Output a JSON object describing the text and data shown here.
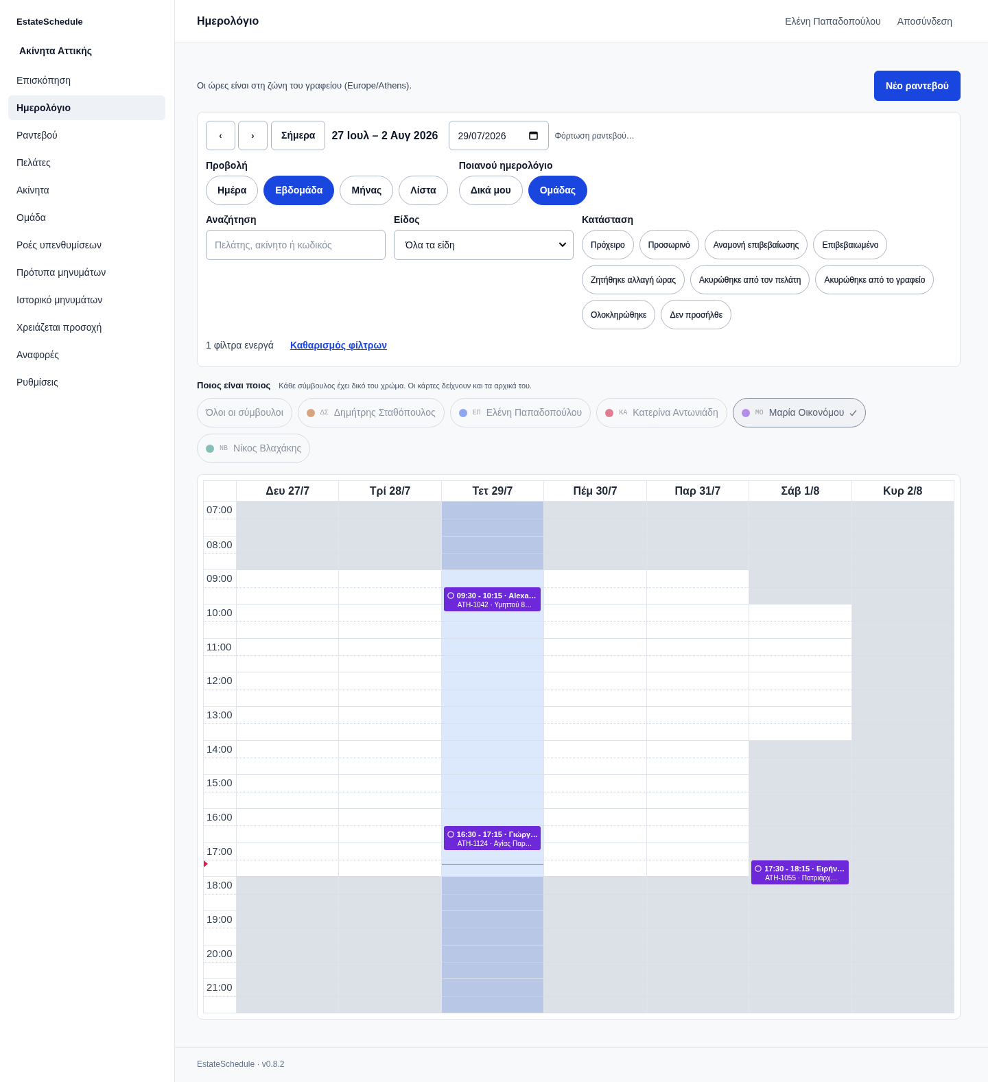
{
  "sidebar": {
    "brand": "EstateSchedule",
    "workspace": "Ακίνητα Αττικής",
    "items": [
      {
        "label": "Επισκόπηση",
        "selected": false
      },
      {
        "label": "Ημερολόγιο",
        "selected": true
      },
      {
        "label": "Ραντεβού",
        "selected": false
      },
      {
        "label": "Πελάτες",
        "selected": false
      },
      {
        "label": "Ακίνητα",
        "selected": false
      },
      {
        "label": "Ομάδα",
        "selected": false
      },
      {
        "label": "Ροές υπενθυμίσεων",
        "selected": false
      },
      {
        "label": "Πρότυπα μηνυμάτων",
        "selected": false
      },
      {
        "label": "Ιστορικό μηνυμάτων",
        "selected": false
      },
      {
        "label": "Χρειάζεται προσοχή",
        "selected": false
      },
      {
        "label": "Αναφορές",
        "selected": false
      },
      {
        "label": "Ρυθμίσεις",
        "selected": false
      }
    ]
  },
  "header": {
    "title": "Ημερολόγιο",
    "user": "Ελένη Παπαδοπούλου",
    "logout": "Αποσύνδεση"
  },
  "intro": {
    "note": "Οι ώρες είναι στη ζώνη του γραφείου (Europe/Athens).",
    "new_button": "Νέο ραντεβού"
  },
  "filters": {
    "prev": "‹",
    "next": "›",
    "today_button": "Σήμερα",
    "range": "27 Ιουλ – 2 Αυγ 2026",
    "date": "29/07/2026",
    "loading": "Φόρτωση ραντεβού…",
    "view": {
      "label": "Προβολή",
      "options": [
        {
          "label": "Ημέρα",
          "selected": false
        },
        {
          "label": "Εβδομάδα",
          "selected": true
        },
        {
          "label": "Μήνας",
          "selected": false
        },
        {
          "label": "Λίστα",
          "selected": false
        }
      ]
    },
    "scope": {
      "label": "Ποιανού ημερολόγιο",
      "options": [
        {
          "label": "Δικά μου",
          "selected": false
        },
        {
          "label": "Ομάδας",
          "selected": true
        }
      ]
    },
    "search": {
      "label": "Αναζήτηση",
      "placeholder": "Πελάτης, ακίνητο ή κωδικός"
    },
    "type": {
      "label": "Είδος",
      "value": "Όλα τα είδη"
    },
    "status": {
      "label": "Κατάσταση",
      "options": [
        {
          "label": "Πρόχειρο",
          "selected": false
        },
        {
          "label": "Προσωρινό",
          "selected": false
        },
        {
          "label": "Αναμονή επιβεβαίωσης",
          "selected": false
        },
        {
          "label": "Επιβεβαιωμένο",
          "selected": false
        },
        {
          "label": "Ζητήθηκε αλλαγή ώρας",
          "selected": false
        },
        {
          "label": "Ακυρώθηκε από τον πελάτη",
          "selected": false
        },
        {
          "label": "Ακυρώθηκε από το γραφείο",
          "selected": false
        },
        {
          "label": "Ολοκληρώθηκε",
          "selected": false
        },
        {
          "label": "Δεν προσήλθε",
          "selected": false
        }
      ]
    },
    "active_count": "1 φίλτρα ενεργά",
    "clear_link": "Καθαρισμός φίλτρων"
  },
  "legend": {
    "title": "Ποιος είναι ποιος",
    "description": "Κάθε σύμβουλος έχει δικό του χρώμα. Οι κάρτες δείχνουν και τα αρχικά του.",
    "advisors": [
      {
        "kind": "all",
        "name": "Όλοι οι σύμβουλοι",
        "selected": false
      },
      {
        "kind": "person",
        "initials": "ΔΣ",
        "name": "Δημήτρης Σταθόπουλος",
        "color": "#d8a47f",
        "selected": false
      },
      {
        "kind": "person",
        "initials": "ΕΠ",
        "name": "Ελένη Παπαδοπούλου",
        "color": "#8ea6ee",
        "selected": false
      },
      {
        "kind": "person",
        "initials": "ΚΑ",
        "name": "Κατερίνα Αντωνιάδη",
        "color": "#e07d93",
        "selected": false
      },
      {
        "kind": "person",
        "initials": "ΜΟ",
        "name": "Μαρία Οικονόμου",
        "color": "#b48de8",
        "selected": true
      },
      {
        "kind": "person",
        "initials": "ΝΒ",
        "name": "Νίκος Βλαχάκης",
        "color": "#86bfb6",
        "selected": false
      }
    ]
  },
  "calendar": {
    "hours": [
      "07:00",
      "08:00",
      "09:00",
      "10:00",
      "11:00",
      "12:00",
      "13:00",
      "14:00",
      "15:00",
      "16:00",
      "17:00",
      "18:00",
      "19:00",
      "20:00",
      "21:00"
    ],
    "now_line": {
      "level": 0.709
    },
    "days": [
      {
        "label": "Δευ 27/7",
        "today": false,
        "cells": [
          {
            "off": true
          },
          {
            "off": true
          },
          {
            "off": false
          },
          {
            "off": false
          },
          {
            "off": false
          },
          {
            "off": false
          },
          {
            "off": false
          },
          {
            "off": false
          },
          {
            "off": false
          },
          {
            "off": false
          },
          {
            "off": false
          },
          {
            "off": true
          },
          {
            "off": true
          },
          {
            "off": true
          },
          {
            "off": true
          }
        ]
      },
      {
        "label": "Τρί 28/7",
        "today": false,
        "cells": [
          {
            "off": true
          },
          {
            "off": true
          },
          {
            "off": false
          },
          {
            "off": false
          },
          {
            "off": false
          },
          {
            "off": false
          },
          {
            "off": false
          },
          {
            "off": false
          },
          {
            "off": false
          },
          {
            "off": false
          },
          {
            "off": false
          },
          {
            "off": true
          },
          {
            "off": true
          },
          {
            "off": true
          },
          {
            "off": true
          }
        ]
      },
      {
        "label": "Τετ 29/7",
        "today": true,
        "cells": [
          {
            "off": true
          },
          {
            "off": true
          },
          {
            "off": false,
            "events": [
              {
                "title": "09:30 - 10:15 · Alexa…",
                "detail": "ATH-1042 · Υμηττού 8…",
                "half_past": true
              }
            ]
          },
          {
            "off": false
          },
          {
            "off": false
          },
          {
            "off": false
          },
          {
            "off": false
          },
          {
            "off": false
          },
          {
            "off": false
          },
          {
            "off": false,
            "events": [
              {
                "title": "16:30 - 17:15 · Γιώργ…",
                "detail": "ATH-1124 · Αγίας Παρ…",
                "half_past": true
              }
            ]
          },
          {
            "off": false
          },
          {
            "off": true
          },
          {
            "off": true
          },
          {
            "off": true
          },
          {
            "off": true
          }
        ]
      },
      {
        "label": "Πέμ 30/7",
        "today": false,
        "cells": [
          {
            "off": true
          },
          {
            "off": true
          },
          {
            "off": false
          },
          {
            "off": false
          },
          {
            "off": false
          },
          {
            "off": false
          },
          {
            "off": false
          },
          {
            "off": false
          },
          {
            "off": false
          },
          {
            "off": false
          },
          {
            "off": false
          },
          {
            "off": true
          },
          {
            "off": true
          },
          {
            "off": true
          },
          {
            "off": true
          }
        ]
      },
      {
        "label": "Παρ 31/7",
        "today": false,
        "cells": [
          {
            "off": true
          },
          {
            "off": true
          },
          {
            "off": false
          },
          {
            "off": false
          },
          {
            "off": false
          },
          {
            "off": false
          },
          {
            "off": false
          },
          {
            "off": false
          },
          {
            "off": false
          },
          {
            "off": false
          },
          {
            "off": false
          },
          {
            "off": true
          },
          {
            "off": true
          },
          {
            "off": true
          },
          {
            "off": true
          }
        ]
      },
      {
        "label": "Σάβ 1/8",
        "today": false,
        "cells": [
          {
            "off": true
          },
          {
            "off": true
          },
          {
            "off": true
          },
          {
            "off": false
          },
          {
            "off": false
          },
          {
            "off": false
          },
          {
            "off": false
          },
          {
            "off": true
          },
          {
            "off": true
          },
          {
            "off": true
          },
          {
            "off": true,
            "events": [
              {
                "title": "17:30 - 18:15 · Ειρήν…",
                "detail": "ATH-1055 · Πατριάρχ…",
                "half_past": true
              }
            ]
          },
          {
            "off": true
          },
          {
            "off": true
          },
          {
            "off": true
          },
          {
            "off": true
          }
        ]
      },
      {
        "label": "Κυρ 2/8",
        "today": false,
        "cells": [
          {
            "off": true
          },
          {
            "off": true
          },
          {
            "off": true
          },
          {
            "off": true
          },
          {
            "off": true
          },
          {
            "off": true
          },
          {
            "off": true
          },
          {
            "off": true
          },
          {
            "off": true
          },
          {
            "off": true
          },
          {
            "off": true
          },
          {
            "off": true
          },
          {
            "off": true
          },
          {
            "off": true
          },
          {
            "off": true
          }
        ]
      }
    ]
  },
  "footer": "EstateSchedule · v0.8.2"
}
